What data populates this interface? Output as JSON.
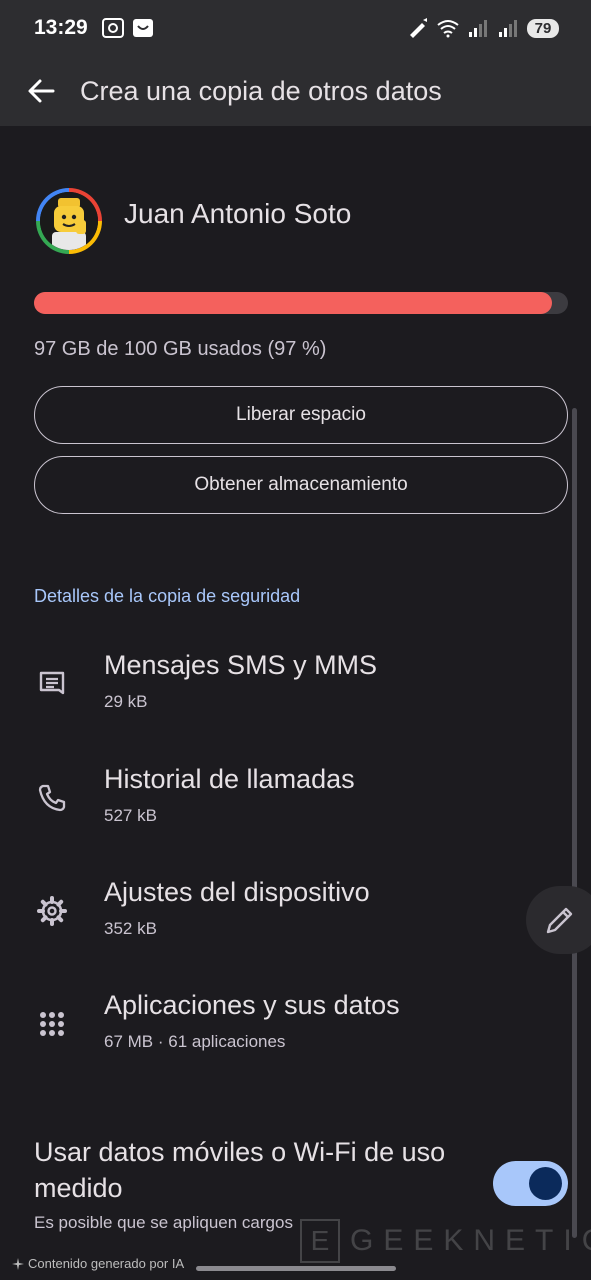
{
  "status_bar": {
    "time": "13:29",
    "battery": "79"
  },
  "app_bar": {
    "title": "Crea una copia de otros datos"
  },
  "profile": {
    "name": "Juan Antonio Soto"
  },
  "storage": {
    "used_fraction": 0.97,
    "summary": "97 GB de 100 GB usados (97 %)"
  },
  "buttons": {
    "free_space": "Liberar espacio",
    "get_storage": "Obtener almacenamiento"
  },
  "backup_details": {
    "header": "Detalles de la copia de seguridad",
    "items": [
      {
        "title": "Mensajes SMS y MMS",
        "subtitle": "29 kB",
        "icon": "message-icon"
      },
      {
        "title": "Historial de llamadas",
        "subtitle": "527 kB",
        "icon": "phone-icon"
      },
      {
        "title": "Ajustes del dispositivo",
        "subtitle": "352 kB",
        "icon": "gear-icon"
      },
      {
        "title": "Aplicaciones y sus datos",
        "subtitle": "67 MB · 61 aplicaciones",
        "icon": "apps-grid-icon"
      }
    ]
  },
  "metered": {
    "title": "Usar datos móviles o Wi-Fi de uso medido",
    "subtitle": "Es posible que se apliquen cargos",
    "enabled": true
  },
  "footer": {
    "ai_note": "Contenido generado por IA",
    "watermark_letter": "E",
    "watermark_text": "GEEKNETIC"
  },
  "colors": {
    "accent": "#a8c7fa",
    "storage_fill": "#f4615d",
    "background": "#1c1b1f"
  }
}
